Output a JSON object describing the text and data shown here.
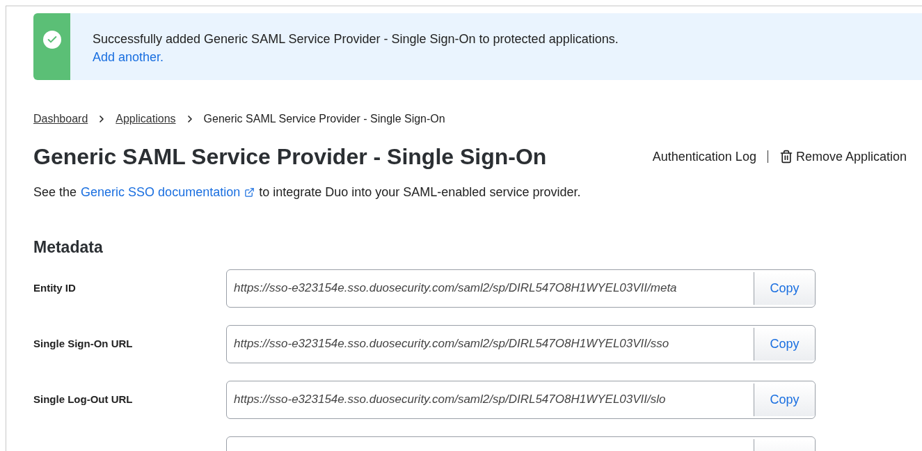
{
  "banner": {
    "message": "Successfully added Generic SAML Service Provider - Single Sign-On to protected applications.",
    "link": "Add another."
  },
  "breadcrumb": [
    {
      "label": "Dashboard",
      "kind": "link"
    },
    {
      "label": "Applications",
      "kind": "link"
    },
    {
      "label": "Generic SAML Service Provider - Single Sign-On",
      "kind": "current"
    }
  ],
  "title": "Generic SAML Service Provider - Single Sign-On",
  "actions": [
    {
      "label": "Authentication Log",
      "kind": "link"
    },
    {
      "label": "Remove Application",
      "kind": "remove"
    }
  ],
  "intro": {
    "before": "See the",
    "link": "Generic SSO documentation",
    "after": "to integrate Duo into your SAML-enabled service provider."
  },
  "section": "Metadata",
  "fields": [
    {
      "kind": "url",
      "label": "Entity ID",
      "value": "https://sso-e323154e.sso.duosecurity.com/saml2/sp/DIRL547O8H1WYEL03VII/meta",
      "button": "Copy"
    },
    {
      "kind": "url",
      "label": "Single Sign-On URL",
      "value": "https://sso-e323154e.sso.duosecurity.com/saml2/sp/DIRL547O8H1WYEL03VII/sso",
      "button": "Copy"
    },
    {
      "kind": "url",
      "label": "Single Log-Out URL",
      "value": "https://sso-e323154e.sso.duosecurity.com/saml2/sp/DIRL547O8H1WYEL03VII/slo",
      "button": "Copy"
    },
    {
      "kind": "cut-off"
    }
  ]
}
